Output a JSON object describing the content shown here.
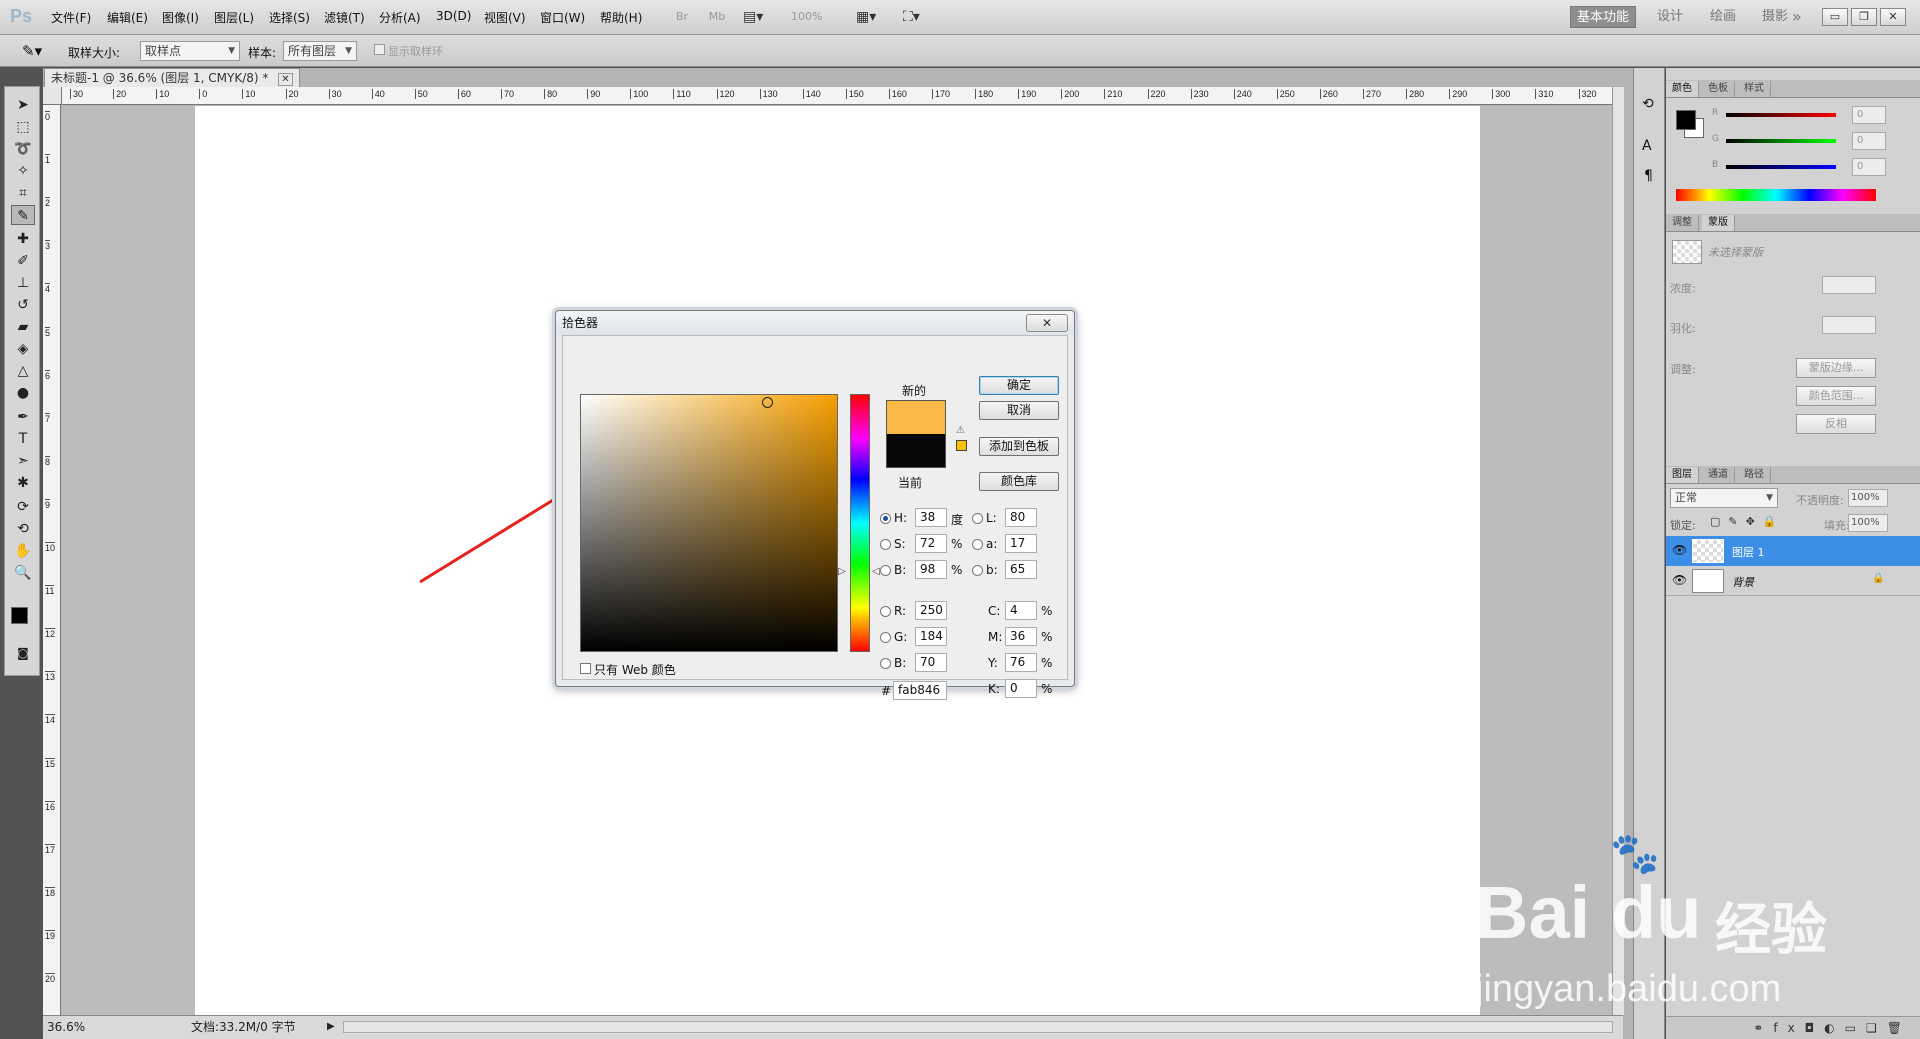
{
  "app": {
    "logo": "Ps"
  },
  "menu": [
    "文件(F)",
    "编辑(E)",
    "图像(I)",
    "图层(L)",
    "选择(S)",
    "滤镜(T)",
    "分析(A)",
    "3D(D)",
    "视图(V)",
    "窗口(W)",
    "帮助(H)"
  ],
  "menubar_right": {
    "br": "Br",
    "mb": "Mb",
    "zoom": "100%"
  },
  "workspaces": {
    "active": "基本功能",
    "items": [
      "设计",
      "绘画",
      "摄影"
    ],
    "more": "»"
  },
  "window_buttons": [
    "▭",
    "❐",
    "✕"
  ],
  "options": {
    "sample_size_label": "取样大小:",
    "sample_size_value": "取样点",
    "sample_label": "样本:",
    "sample_value": "所有图层",
    "show_ring_label": "显示取样环"
  },
  "document": {
    "tab_title": "未标题-1 @ 36.6% (图层 1, CMYK/8) *",
    "ruler_h": [
      "30",
      "20",
      "10",
      "0",
      "10",
      "20",
      "30",
      "40",
      "50",
      "60",
      "70",
      "80",
      "90",
      "100",
      "110",
      "120",
      "130",
      "140",
      "150",
      "160",
      "170",
      "180",
      "190",
      "200",
      "210",
      "220",
      "230",
      "240",
      "250",
      "260",
      "270",
      "280",
      "290",
      "300",
      "310",
      "320"
    ],
    "ruler_v": [
      "0",
      "1",
      "2",
      "3",
      "4",
      "5",
      "6",
      "7",
      "8",
      "9",
      "10",
      "11",
      "12",
      "13",
      "14",
      "15",
      "16",
      "17",
      "18",
      "19",
      "20"
    ],
    "status_zoom": "36.6%",
    "status_doc": "文档:33.2M/0 字节"
  },
  "color_panel": {
    "tabs": [
      "颜色",
      "色板",
      "样式"
    ],
    "r_label": "R",
    "g_label": "G",
    "b_label": "B",
    "r": "0",
    "g": "0",
    "b": "0",
    "foreground": "#000000",
    "background": "#ffffff"
  },
  "masks_panel": {
    "tabs": [
      "调整",
      "蒙版"
    ],
    "no_mask": "未选择蒙版",
    "density_label": "浓度:",
    "feather_label": "羽化:",
    "refine_label": "调整:",
    "mask_edge_button": "蒙版边缘...",
    "color_range_button": "颜色范围...",
    "invert_button": "反相"
  },
  "layers_panel": {
    "tabs": [
      "图层",
      "通道",
      "路径"
    ],
    "blend_mode": "正常",
    "opacity_label": "不透明度:",
    "opacity": "100%",
    "lock_label": "锁定:",
    "fill_label": "填充:",
    "fill": "100%",
    "layers": [
      {
        "name": "图层 1",
        "selected": true
      },
      {
        "name": "背景",
        "selected": false,
        "locked": true
      }
    ]
  },
  "color_picker": {
    "title": "拾色器",
    "new_label": "新的",
    "current_label": "当前",
    "new_color": "#fab846",
    "current_color": "#060606",
    "ok_button": "确定",
    "cancel_button": "取消",
    "add_swatch_button": "添加到色板",
    "color_libraries_button": "颜色库",
    "web_only_label": "只有 Web 颜色",
    "H": {
      "label": "H:",
      "value": "38",
      "unit": "度"
    },
    "S": {
      "label": "S:",
      "value": "72",
      "unit": "%"
    },
    "Bv": {
      "label": "B:",
      "value": "98",
      "unit": "%"
    },
    "R": {
      "label": "R:",
      "value": "250"
    },
    "G": {
      "label": "G:",
      "value": "184"
    },
    "B": {
      "label": "B:",
      "value": "70"
    },
    "L": {
      "label": "L:",
      "value": "80"
    },
    "a": {
      "label": "a:",
      "value": "17"
    },
    "b": {
      "label": "b:",
      "value": "65"
    },
    "C": {
      "label": "C:",
      "value": "4",
      "unit": "%"
    },
    "M": {
      "label": "M:",
      "value": "36",
      "unit": "%"
    },
    "Y": {
      "label": "Y:",
      "value": "76",
      "unit": "%"
    },
    "K": {
      "label": "K:",
      "value": "0",
      "unit": "%"
    },
    "hex_label": "#",
    "hex": "fab846"
  },
  "watermark": {
    "brand": "Bai",
    "brand2": "du",
    "cn": "经验",
    "url": "jingyan.baidu.com"
  }
}
